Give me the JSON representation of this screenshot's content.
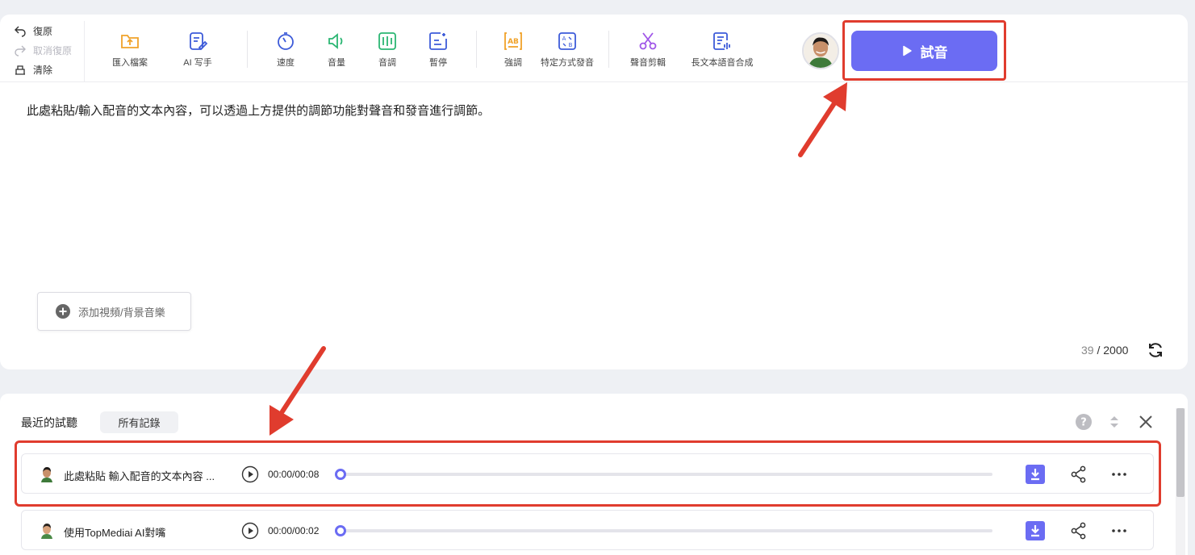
{
  "toolbar": {
    "history": {
      "undo": "復原",
      "redo": "取消復原",
      "clear": "清除"
    },
    "tools": [
      {
        "label": "匯入檔案",
        "icon": "folder-import-icon"
      },
      {
        "label": "AI 写手",
        "icon": "ai-writer-icon"
      },
      {
        "label": "速度",
        "icon": "speed-icon"
      },
      {
        "label": "音量",
        "icon": "volume-icon"
      },
      {
        "label": "音調",
        "icon": "pitch-icon"
      },
      {
        "label": "暫停",
        "icon": "pause-icon"
      },
      {
        "label": "強調",
        "icon": "emphasis-icon"
      },
      {
        "label": "特定方式發音",
        "icon": "pronunciation-icon"
      },
      {
        "label": "聲音剪輯",
        "icon": "scissors-icon"
      },
      {
        "label": "長文本語音合成",
        "icon": "long-text-icon"
      }
    ],
    "try_label": "試音"
  },
  "editor": {
    "text": "此處粘貼/輸入配音的文本內容，可以透過上方提供的調節功能對聲音和發音進行調節。",
    "add_media_label": "添加視頻/背景音樂",
    "char_count": "39",
    "char_limit": "/ 2000"
  },
  "history_panel": {
    "title": "最近的試聽",
    "all_records_label": "所有記錄",
    "records": [
      {
        "name": "此處粘貼 輸入配音的文本內容 ...",
        "time": "00:00/00:08",
        "progress": 0
      },
      {
        "name": "使用TopMediai AI對嘴",
        "time": "00:00/00:02",
        "progress": 0
      }
    ]
  },
  "colors": {
    "accent": "#6b6cf3",
    "highlight": "#e03c2e",
    "orange": "#f0a22a",
    "blue": "#3d5bd9",
    "green": "#2bb673",
    "purple": "#a056e8"
  }
}
